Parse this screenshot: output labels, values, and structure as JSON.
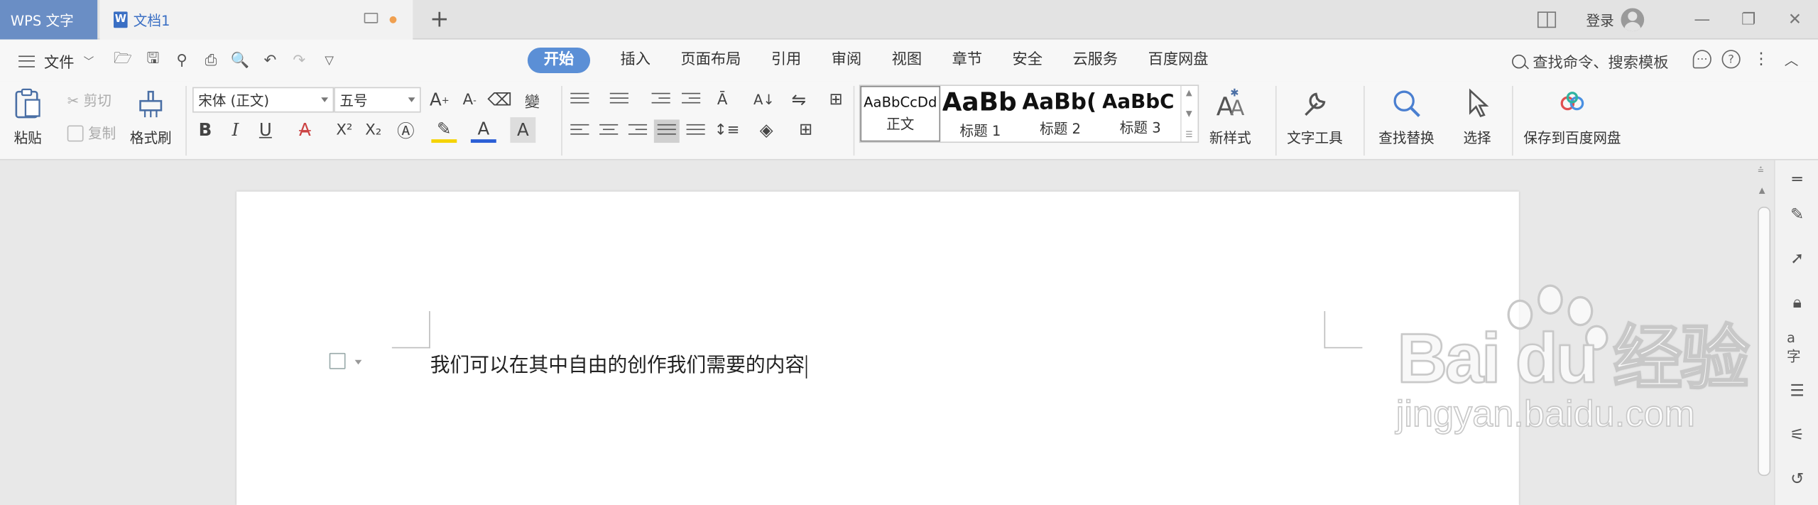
{
  "titlebar": {
    "app_name": "WPS 文字",
    "doc_tab": "文档1",
    "doc_tab_icon": "W",
    "new_tab": "+",
    "login": "登录"
  },
  "menu": {
    "file": "文件",
    "tabs": [
      "开始",
      "插入",
      "页面布局",
      "引用",
      "审阅",
      "视图",
      "章节",
      "安全",
      "云服务",
      "百度网盘"
    ],
    "active_tab": "开始",
    "search": "查找命令、搜索模板"
  },
  "ribbon": {
    "paste": "粘贴",
    "cut": "剪切",
    "copy": "复制",
    "format_painter": "格式刷",
    "font_name": "宋体 (正文)",
    "font_size": "五号",
    "styles": [
      {
        "sample": "AaBbCcDd",
        "name": "正文"
      },
      {
        "sample": "AaBb",
        "name": "标题 1"
      },
      {
        "sample": "AaBb(",
        "name": "标题 2"
      },
      {
        "sample": "AaBbC",
        "name": "标题 3"
      }
    ],
    "new_style": "新样式",
    "text_tools": "文字工具",
    "find_replace": "查找替换",
    "select": "选择",
    "save_to_baidu": "保存到百度网盘"
  },
  "document": {
    "content": "我们可以在其中自由的创作我们需要的内容"
  },
  "watermark": {
    "logo": "Bai du 经验",
    "url": "jingyan.baidu.com"
  },
  "colors": {
    "app_tab": "#6a8ec5",
    "active_tab": "#5b8fd6",
    "doc_tab_text": "#3a6fc4",
    "unsaved_dot": "#f0a050"
  }
}
